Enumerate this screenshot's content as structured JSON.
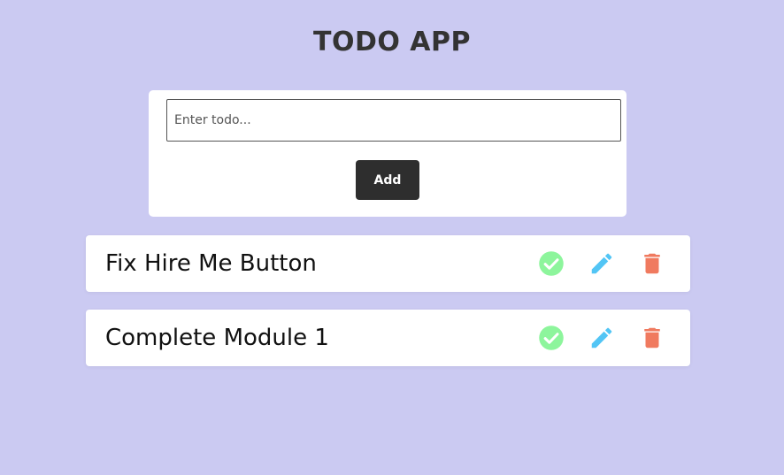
{
  "app": {
    "title": "TODO APP"
  },
  "form": {
    "input_placeholder": "Enter todo...",
    "input_value": "",
    "add_label": "Add"
  },
  "todos": [
    {
      "text": "Fix Hire Me Button"
    },
    {
      "text": "Complete Module 1"
    }
  ],
  "actions": {
    "complete_icon": "check-circle-icon",
    "edit_icon": "pencil-icon",
    "delete_icon": "trash-icon"
  },
  "colors": {
    "background": "#cbcaf2",
    "complete": "#8df59c",
    "edit": "#52c5f5",
    "delete": "#f07a5f",
    "button": "#2e2e2e"
  }
}
